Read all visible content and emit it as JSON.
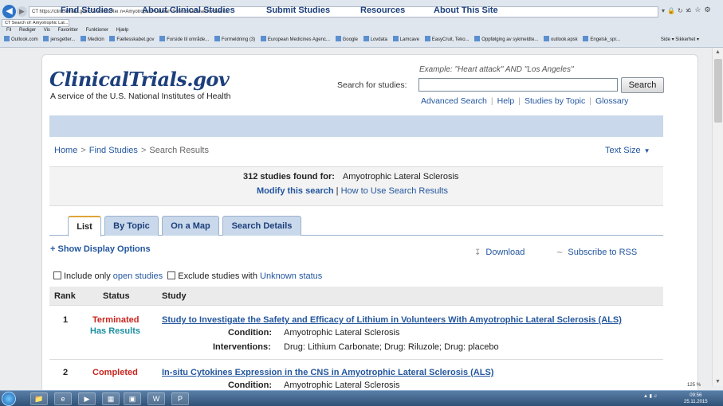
{
  "browser": {
    "url": "CT https://clinicaltrials.gov/ct2/results?term=Amyotrophic+Lateral+Sclerosis&Search=Search",
    "tab_title": "CT Search of: Amyotrophic Lat...",
    "menu": [
      "Fil",
      "Rediger",
      "Vis",
      "Favoritter",
      "Funktioner",
      "Hjælp"
    ],
    "favorites": [
      "Outlook.com",
      "jensgetter...",
      "Medicin",
      "Fællesskabet.gov",
      "Forside til område...",
      "Formeldning (3)",
      "European Medicines Agenc...",
      "Google",
      "Lovdata",
      "Lamcave",
      "EasyCruit, Teko...",
      "Oppfølging av sykmeldte...",
      "outlook.epsk",
      "Engelsk_spr..."
    ],
    "tools": [
      "Side",
      "Sikkerhet"
    ],
    "zoom": "125 %"
  },
  "site": {
    "logo": "ClinicalTrials.gov",
    "tagline": "A service of the U.S. National Institutes of Health"
  },
  "search": {
    "example": "Example: \"Heart attack\" AND \"Los Angeles\"",
    "label": "Search for studies:",
    "value": "",
    "button": "Search",
    "links": [
      "Advanced Search",
      "Help",
      "Studies by Topic",
      "Glossary"
    ]
  },
  "nav": [
    "Find Studies",
    "About Clinical Studies",
    "Submit Studies",
    "Resources",
    "About This Site"
  ],
  "breadcrumb": {
    "home": "Home",
    "find": "Find Studies",
    "current": "Search Results",
    "separator": ">"
  },
  "textsize": "Text Size",
  "results": {
    "count_text": "312 studies found for:",
    "query": "Amyotrophic Lateral Sclerosis",
    "modify": "Modify this search",
    "divider": "|",
    "howto": "How to Use Search Results"
  },
  "tabs": [
    "List",
    "By Topic",
    "On a Map",
    "Search Details"
  ],
  "options": {
    "show_display": "+ Show Display Options",
    "download": "Download",
    "rss": "Subscribe to RSS"
  },
  "filters": {
    "include_prefix": "Include only",
    "include_link": "open studies",
    "exclude_prefix": "Exclude studies with",
    "exclude_link": "Unknown status"
  },
  "table": {
    "headers": [
      "Rank",
      "Status",
      "Study"
    ],
    "rows": [
      {
        "rank": "1",
        "status": "Terminated",
        "results": "Has Results",
        "title": "Study to Investigate the Safety and Efficacy of Lithium in Volunteers With Amyotrophic Lateral Sclerosis (ALS)",
        "condition_label": "Condition:",
        "condition": "Amyotrophic Lateral Sclerosis",
        "interventions_label": "Interventions:",
        "interventions": "Drug: Lithium Carbonate;   Drug: Riluzole;   Drug: placebo"
      },
      {
        "rank": "2",
        "status": "Completed",
        "title": "In-situ Cytokines Expression in the CNS in Amyotrophic Lateral Sclerosis (ALS)",
        "condition_label": "Condition:",
        "condition": "Amyotrophic Lateral Sclerosis"
      }
    ]
  },
  "taskbar": {
    "time": "09:56",
    "date": "25.11.2015"
  }
}
